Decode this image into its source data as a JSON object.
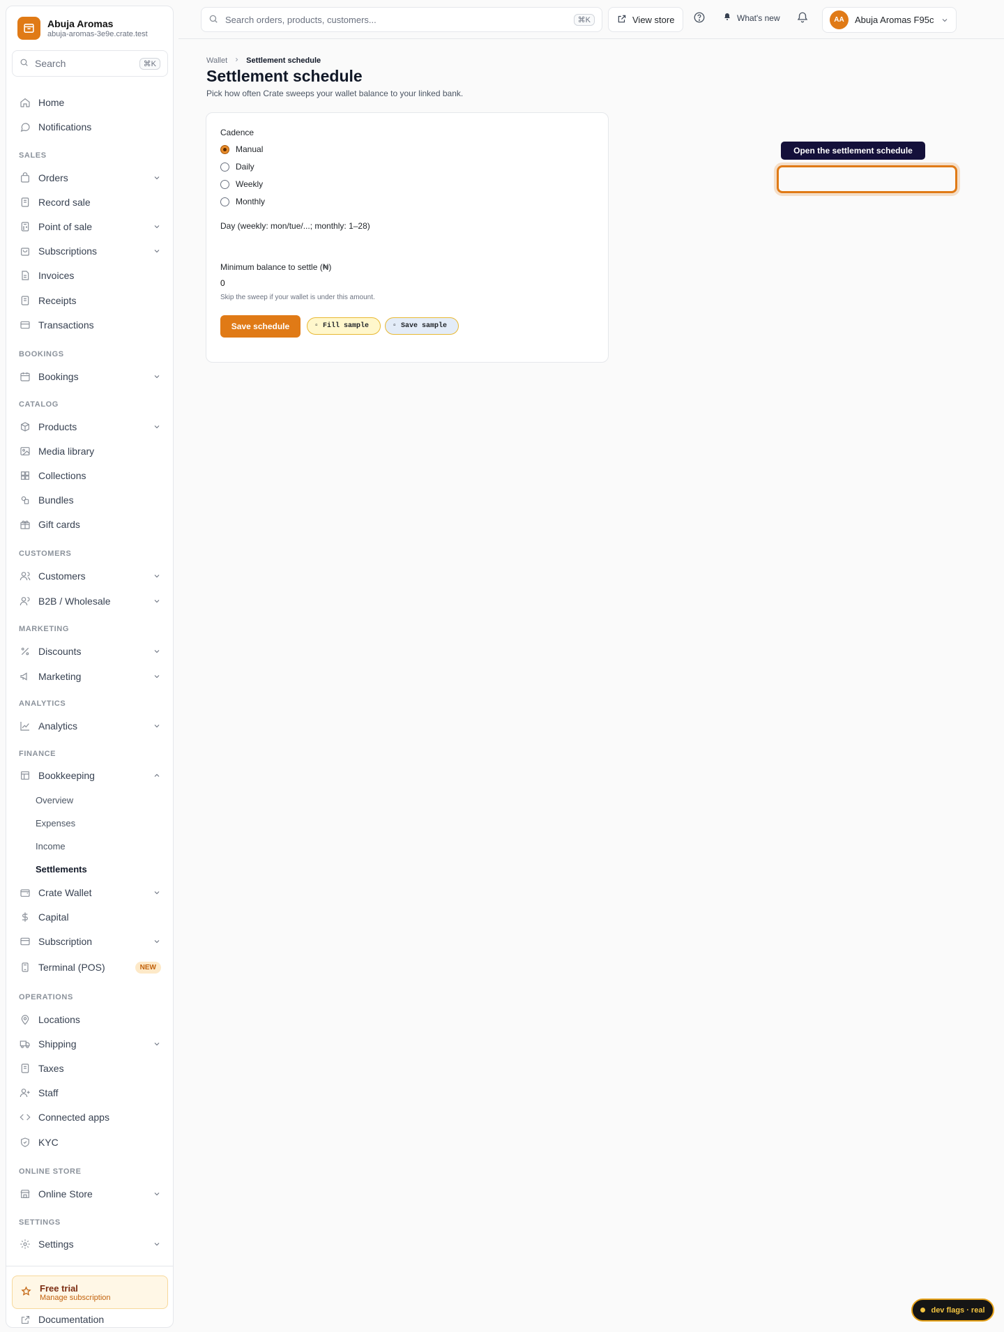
{
  "brand": {
    "name": "Abuja Aromas",
    "domain": "abuja-aromas-3e9e.crate.test"
  },
  "sidebar_search": {
    "placeholder": "Search",
    "shortcut": "⌘K"
  },
  "nav": {
    "home": "Home",
    "notifications": "Notifications",
    "sec_sales": "SALES",
    "orders": "Orders",
    "record_sale": "Record sale",
    "pos": "Point of sale",
    "subscriptions": "Subscriptions",
    "invoices": "Invoices",
    "receipts": "Receipts",
    "transactions": "Transactions",
    "sec_bookings": "BOOKINGS",
    "bookings": "Bookings",
    "sec_catalog": "CATALOG",
    "products": "Products",
    "media_library": "Media library",
    "collections": "Collections",
    "bundles": "Bundles",
    "gift_cards": "Gift cards",
    "sec_customers": "CUSTOMERS",
    "customers": "Customers",
    "b2b": "B2B / Wholesale",
    "sec_marketing": "MARKETING",
    "discounts": "Discounts",
    "marketing": "Marketing",
    "sec_analytics": "ANALYTICS",
    "analytics": "Analytics",
    "sec_finance": "FINANCE",
    "bookkeeping": "Bookkeeping",
    "bk_overview": "Overview",
    "bk_expenses": "Expenses",
    "bk_income": "Income",
    "bk_settlements": "Settlements",
    "crate_wallet": "Crate Wallet",
    "capital": "Capital",
    "subscription": "Subscription",
    "terminal": "Terminal (POS)",
    "terminal_badge": "NEW",
    "sec_operations": "OPERATIONS",
    "locations": "Locations",
    "shipping": "Shipping",
    "taxes": "Taxes",
    "staff": "Staff",
    "connected_apps": "Connected apps",
    "kyc": "KYC",
    "sec_online_store": "ONLINE STORE",
    "online_store": "Online Store",
    "sec_settings": "SETTINGS",
    "settings": "Settings"
  },
  "trial": {
    "title": "Free trial",
    "subtitle": "Manage subscription"
  },
  "documentation": "Documentation",
  "topbar": {
    "search_placeholder": "Search orders, products, customers...",
    "search_shortcut": "⌘K",
    "view_store": "View store",
    "whats_new": "What's new",
    "account_initials": "AA",
    "account_name": "Abuja Aromas F95c"
  },
  "breadcrumb": {
    "parent": "Wallet",
    "current": "Settlement schedule"
  },
  "page": {
    "title": "Settlement schedule",
    "subtitle": "Pick how often Crate sweeps your wallet balance to your linked bank."
  },
  "form": {
    "cadence_label": "Cadence",
    "cadence_options": [
      "Manual",
      "Daily",
      "Weekly",
      "Monthly"
    ],
    "cadence_selected": "Manual",
    "day_label": "Day (weekly: mon/tue/...; monthly: 1–28)",
    "min_balance_label": "Minimum balance to settle (₦)",
    "min_balance_value": "0",
    "min_balance_hint": "Skip the sweep if your wallet is under this amount.",
    "save_button": "Save schedule",
    "fill_sample": "Fill sample",
    "save_sample": "Save sample"
  },
  "tooltip": {
    "text": "Open the settlement schedule"
  },
  "dev_flags": "dev flags · real",
  "colors": {
    "accent": "#e07a16",
    "tooltip_bg": "#14103a"
  }
}
